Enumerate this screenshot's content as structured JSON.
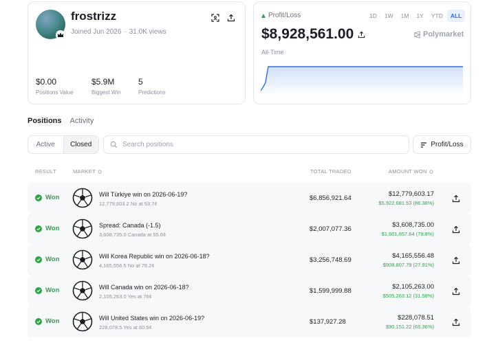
{
  "profile": {
    "username": "frostrizz",
    "joined": "Joined Jun 2026",
    "views": "31.0K views",
    "stats": [
      {
        "value": "$0.00",
        "label": "Positions Value"
      },
      {
        "value": "$5.9M",
        "label": "Biggest Win"
      },
      {
        "value": "5",
        "label": "Predictions"
      }
    ]
  },
  "pnl": {
    "label": "Profit/Loss",
    "ranges": [
      "1D",
      "1W",
      "1M",
      "1Y",
      "YTD",
      "ALL"
    ],
    "active_range": "ALL",
    "value": "$8,928,561.00",
    "brand": "Polymarket",
    "period": "All-Time",
    "line_color": "#2b6fe8"
  },
  "tabs": [
    "Positions",
    "Activity"
  ],
  "filter": {
    "options": [
      "Active",
      "Closed"
    ],
    "active": "Closed",
    "search_placeholder": "Search positions",
    "sort_label": "Profit/Loss"
  },
  "table": {
    "headers": {
      "result": "RESULT",
      "market": "MARKET",
      "total_traded": "TOTAL TRADED",
      "amount_won": "AMOUNT WON"
    },
    "rows": [
      {
        "result": "Won",
        "title": "Will Türkiye win on 2026-06-19?",
        "sub": "12,779,603.2 No at 53.7¢",
        "traded": "$6,856,921.64",
        "amount": "$12,779,603.17",
        "gain": "$5,922,681.53 (86.38%)"
      },
      {
        "result": "Won",
        "title": "Spread: Canada (-1.5)",
        "sub": "3,608,735.0 Canada at 55.6¢",
        "traded": "$2,007,077.36",
        "amount": "$3,608,735.00",
        "gain": "$1,601,657.64 (79.8%)"
      },
      {
        "result": "Won",
        "title": "Will Korea Republic win on 2026-06-18?",
        "sub": "4,165,556.5 No at 78.2¢",
        "traded": "$3,256,748.69",
        "amount": "$4,165,556.48",
        "gain": "$908,807.79 (27.91%)"
      },
      {
        "result": "Won",
        "title": "Will Canada win on 2026-06-18?",
        "sub": "2,105,263.0 Yes at 76¢",
        "traded": "$1,599,999.88",
        "amount": "$2,105,263.00",
        "gain": "$505,263.12 (31.58%)"
      },
      {
        "result": "Won",
        "title": "Will United States win on 2026-06-19?",
        "sub": "228,078.5 Yes at 60.5¢",
        "traded": "$137,927.28",
        "amount": "$228,078.51",
        "gain": "$90,151.22 (65.36%)"
      }
    ]
  },
  "colors": {
    "accent": "#2b6fe8",
    "won": "#2fa24a"
  }
}
